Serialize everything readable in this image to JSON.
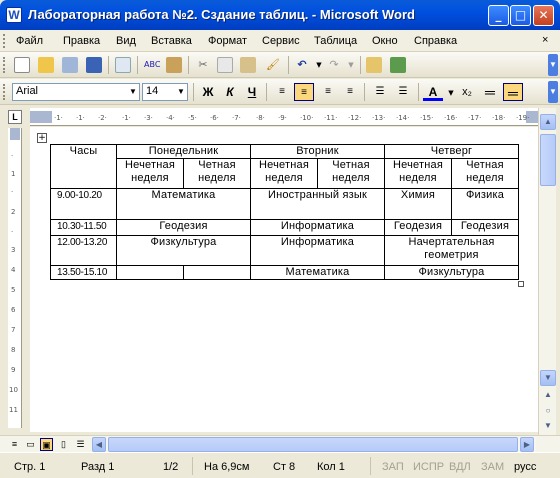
{
  "window": {
    "title": "Лабораторная работа №2. Сздание таблиц. - Microsoft Word",
    "min_icon": "minimize-icon",
    "max_icon": "maximize-icon",
    "close_icon": "close-icon"
  },
  "menu": {
    "items": [
      "Файл",
      "Правка",
      "Вид",
      "Вставка",
      "Формат",
      "Сервис",
      "Таблица",
      "Окно",
      "Справка"
    ],
    "close_glyph": "×"
  },
  "format": {
    "font": "Arial",
    "size": "14",
    "bold": "Ж",
    "italic": "К",
    "underline": "Ч",
    "subscript": "x₂"
  },
  "table": {
    "header": {
      "hours": "Часы",
      "days": [
        "Понедельник",
        "Вторник",
        "Четверг"
      ],
      "odd": "Нечетная неделя",
      "even": "Четная неделя"
    },
    "rows": [
      {
        "time": "9.00-10.20",
        "mon": "Математика",
        "tue": "Иностранный язык",
        "thu_odd": "Химия",
        "thu_even": "Физика"
      },
      {
        "time": "10.30-11.50",
        "mon": "Геодезия",
        "tue": "Информатика",
        "thu_odd": "Геодезия",
        "thu_even": "Геодезия"
      },
      {
        "time": "12.00-13.20",
        "mon": "Физкультура",
        "tue": "Информатика",
        "thu": "Начертательная геометрия"
      },
      {
        "time": "13.50-15.10",
        "tue": "Математика",
        "thu": "Физкультура"
      }
    ]
  },
  "status": {
    "page": "Стр. 1",
    "section": "Разд 1",
    "pages": "1/2",
    "at": "На 6,9см",
    "line": "Ст 8",
    "col": "Кол 1",
    "rec": "ЗАП",
    "trk": "ИСПР",
    "ext": "ВДЛ",
    "ovr": "ЗАМ",
    "lang": "русс"
  },
  "colors": {
    "titlebar": "#0050e0",
    "highlight": "#fbd77e",
    "font_color": "#0000ff",
    "highlight_color": "#ffff00"
  }
}
